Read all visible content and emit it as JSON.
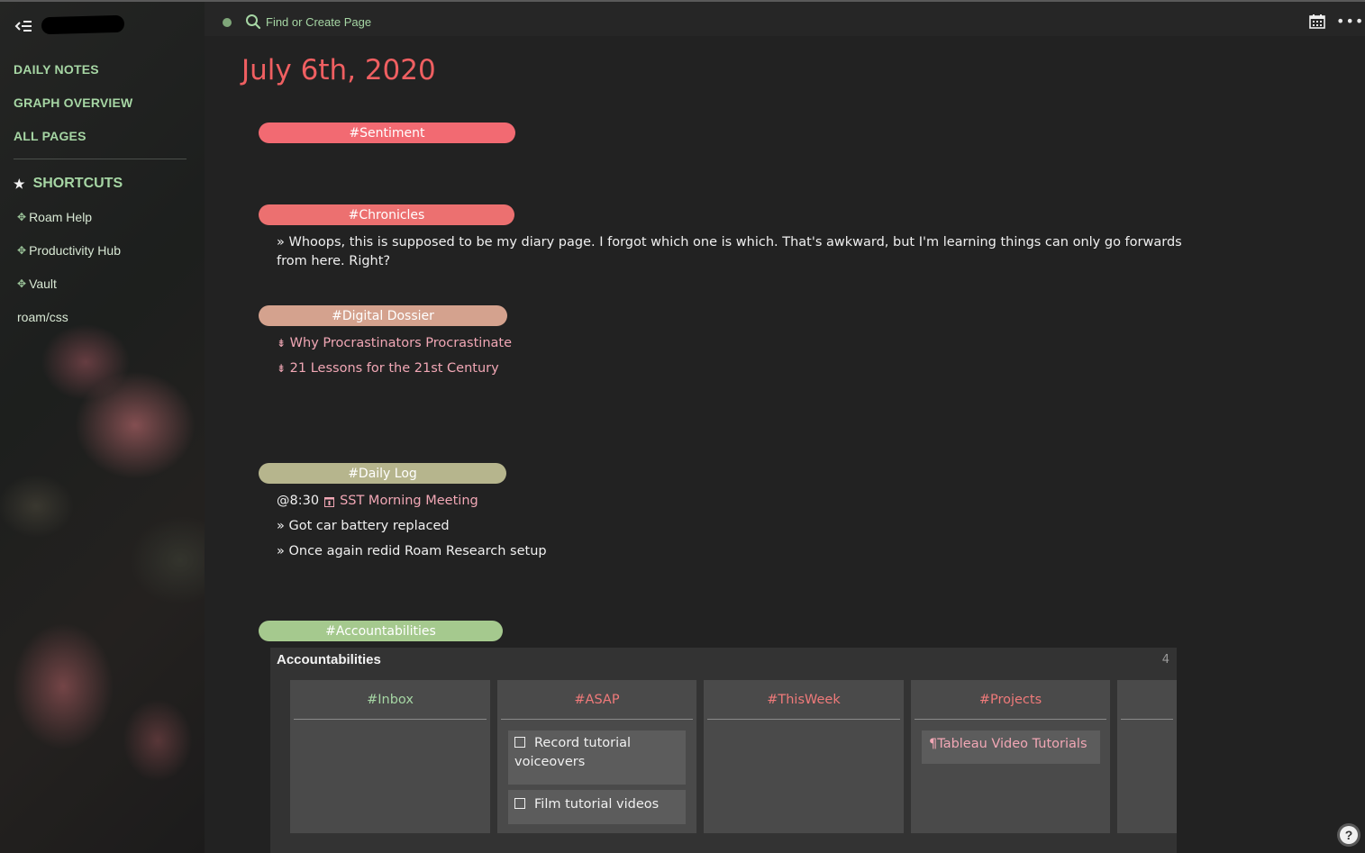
{
  "sidebar": {
    "nav": [
      "DAILY NOTES",
      "GRAPH OVERVIEW",
      "ALL PAGES"
    ],
    "shortcuts_label": "SHORTCUTS",
    "shortcuts": [
      {
        "glyph": "✥",
        "label": "Roam Help"
      },
      {
        "glyph": "✥",
        "label": "Productivity Hub"
      },
      {
        "glyph": "✥",
        "label": "Vault"
      },
      {
        "glyph": "",
        "label": "roam/css"
      }
    ]
  },
  "topbar": {
    "search_label": "Find or Create Page",
    "more_glyph": "•••"
  },
  "page": {
    "title": "July 6th, 2020",
    "sections": {
      "sentiment": {
        "tag": "#Sentiment",
        "color": "#f26a72"
      },
      "chronicles": {
        "tag": "#Chronicles",
        "color": "#ec7070",
        "line1": "» Whoops, this is supposed to be my diary page. I forgot which one is which. That's awkward, but I'm learning things can only go forwards",
        "line2": "from here. Right?"
      },
      "dossier": {
        "tag": "#Digital Dossier",
        "color": "#d4a28e",
        "items": [
          {
            "marker": "⇟",
            "text": "Why Procrastinators Procrastinate"
          },
          {
            "marker": "⇟",
            "text": "21 Lessons for the 21st Century"
          }
        ]
      },
      "daily_log": {
        "tag": "#Daily Log",
        "color": "#b6b58d",
        "time": "@8:30",
        "meeting": "SST Morning Meeting",
        "items": [
          "» Got car battery replaced",
          "» Once again redid Roam Research setup"
        ]
      },
      "accountabilities": {
        "tag": "#Accountabilities",
        "color": "#a5c98e"
      }
    }
  },
  "kanban": {
    "title": "Accountabilities",
    "count": "4",
    "columns": [
      {
        "name": "#Inbox",
        "color": "#a6d6a4",
        "cards": []
      },
      {
        "name": "#ASAP",
        "color": "#ef7a7a",
        "cards": [
          {
            "checkbox": true,
            "line1": "Record tutorial",
            "line2": "voiceovers"
          },
          {
            "checkbox": true,
            "line1": "Film tutorial videos"
          }
        ]
      },
      {
        "name": "#ThisWeek",
        "color": "#ef7a7a",
        "cards": []
      },
      {
        "name": "#Projects",
        "color": "#ef7a7a",
        "cards": [
          {
            "marker": "¶",
            "line1": "Tableau Video Tutorials"
          }
        ]
      }
    ]
  },
  "help": "?"
}
